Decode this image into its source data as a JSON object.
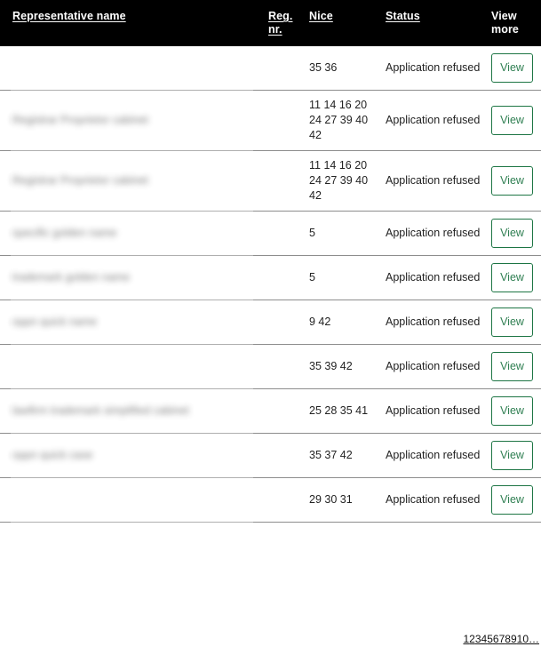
{
  "table": {
    "columns": [
      {
        "key": "name",
        "label": "Representative name",
        "underlined": true
      },
      {
        "key": "reg",
        "label": "Reg. nr.",
        "underlined": true
      },
      {
        "key": "nice",
        "label": "Nice",
        "underlined": true
      },
      {
        "key": "status",
        "label": "Status",
        "underlined": true
      },
      {
        "key": "view",
        "label": "View more",
        "underlined": false
      }
    ],
    "rows": [
      {
        "name": "",
        "reg": "",
        "nice": "35 36",
        "status": "Application refused",
        "view": "View"
      },
      {
        "name": "Registrar Proprietor cabinet",
        "reg": "",
        "nice": "11 14 16 20 24 27 39 40 42",
        "status": "Application refused",
        "view": "View"
      },
      {
        "name": "Registrar Proprietor cabinet",
        "reg": "",
        "nice": "11 14 16 20 24 27 39 40 42",
        "status": "Application refused",
        "view": "View"
      },
      {
        "name": "specific golden name",
        "reg": "",
        "nice": "5",
        "status": "Application refused",
        "view": "View"
      },
      {
        "name": "trademark golden name",
        "reg": "",
        "nice": "5",
        "status": "Application refused",
        "view": "View"
      },
      {
        "name": "oppn quick name",
        "reg": "",
        "nice": "9 42",
        "status": "Application refused",
        "view": "View"
      },
      {
        "name": "",
        "reg": "",
        "nice": "35 39 42",
        "status": "Application refused",
        "view": "View"
      },
      {
        "name": "lawfirm trademark simplified cabinet",
        "reg": "",
        "nice": "25 28 35 41",
        "status": "Application refused",
        "view": "View"
      },
      {
        "name": "oppn quick case",
        "reg": "",
        "nice": "35 37 42",
        "status": "Application refused",
        "view": "View"
      },
      {
        "name": "",
        "reg": "",
        "nice": "29 30 31",
        "status": "Application refused",
        "view": "View"
      }
    ]
  },
  "pagination": {
    "pages": [
      "1",
      "2",
      "3",
      "4",
      "5",
      "6",
      "7",
      "8",
      "9",
      "10"
    ],
    "ellipsis": "…",
    "current": "1"
  },
  "colors": {
    "header_background": "#000000",
    "header_text": "#ffffff",
    "button_border": "#1d7544",
    "button_text": "#2f7f52",
    "row_border": "#8d8d8d",
    "body_text": "#222222"
  }
}
